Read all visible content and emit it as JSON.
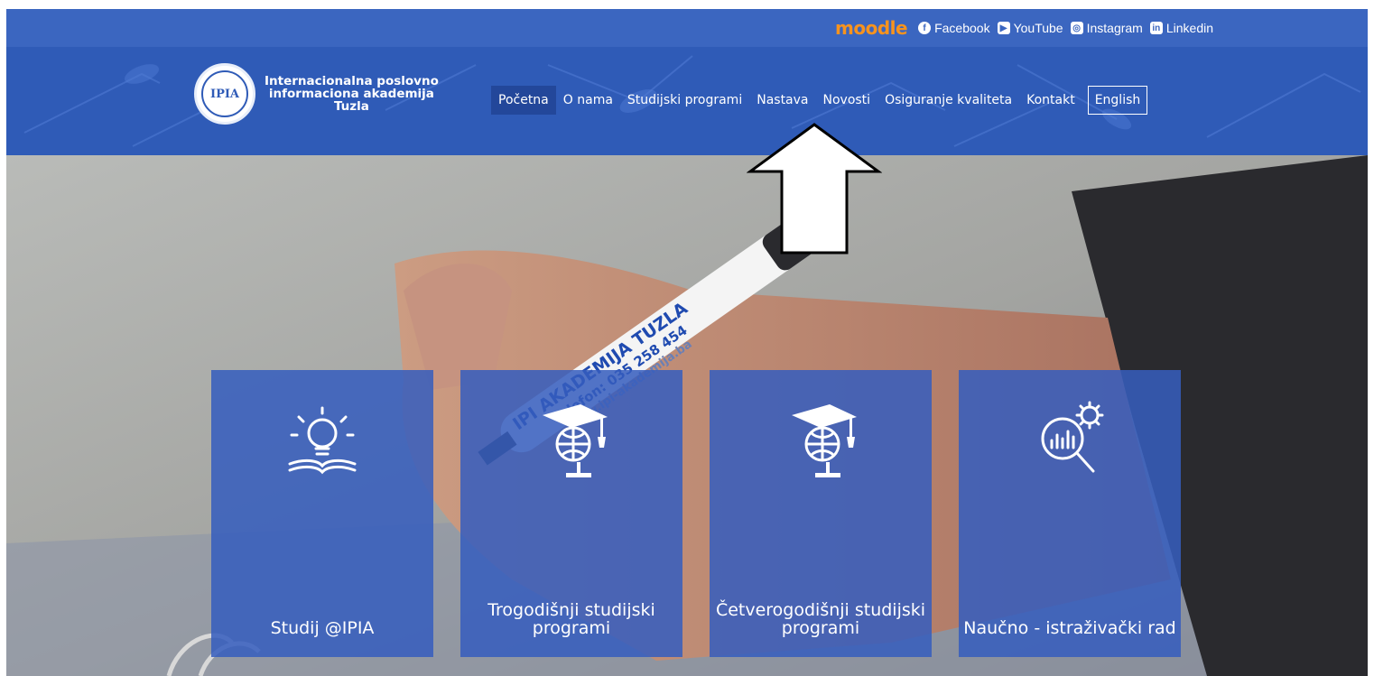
{
  "topbar": {
    "moodle": "moodle",
    "links": [
      "Facebook",
      "YouTube",
      "Instagram",
      "Linkedin"
    ]
  },
  "brand": {
    "seal": "IPIA",
    "name_line1": "Internacionalna poslovno",
    "name_line2": "informaciona akademija",
    "name_line3": "Tuzla"
  },
  "nav": {
    "items": [
      "Početna",
      "O nama",
      "Studijski programi",
      "Nastava",
      "Novosti",
      "Osiguranje kvaliteta",
      "Kontakt"
    ],
    "active": "Početna",
    "language": "English"
  },
  "hero": {
    "pen_line1": "IPI AKADEMIJA TUZLA",
    "pen_line2": "Telefon: 035 258 454",
    "pen_line3": "www.ipi-akademija.ba"
  },
  "cards": [
    {
      "icon": "lightbulb-book-icon",
      "title": "Studij @IPIA"
    },
    {
      "icon": "graduation-globe-icon",
      "title": "Trogodišnji studijski programi"
    },
    {
      "icon": "graduation-globe-icon",
      "title": "Četverogodišnji studijski programi"
    },
    {
      "icon": "research-magnifier-icon",
      "title": "Naučno - istraživački rad"
    }
  ],
  "colors": {
    "topbar": "#3b66c0",
    "header": "#2f5bb7",
    "card": "#355dbe",
    "moodle": "#f7931e"
  }
}
